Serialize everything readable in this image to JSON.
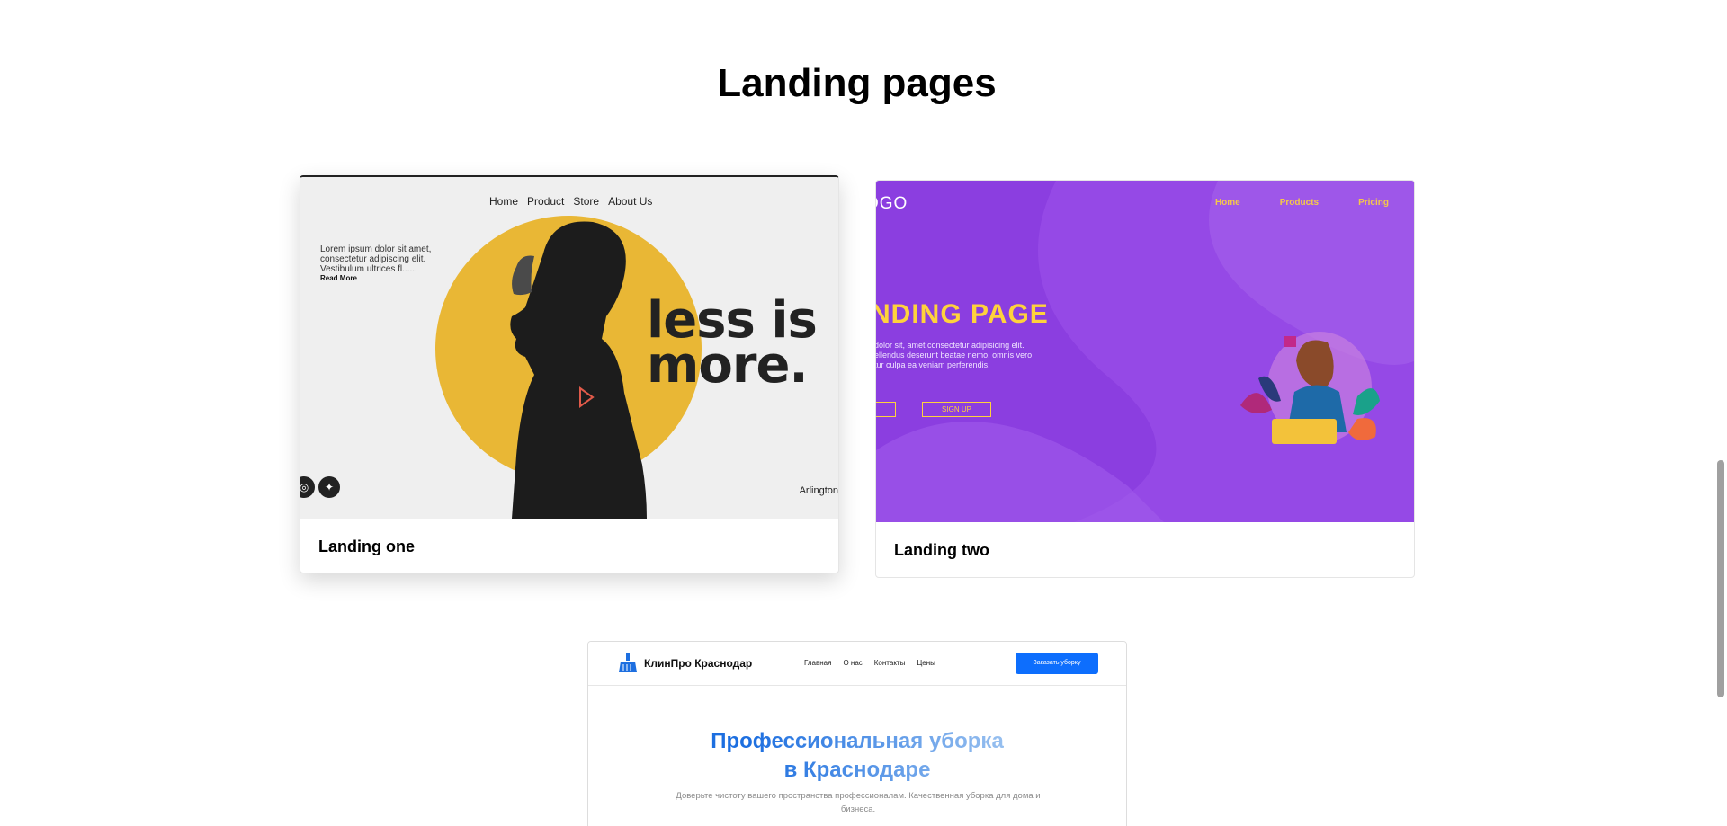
{
  "section": {
    "title": "Landing pages"
  },
  "cards": {
    "one": {
      "label": "Landing one",
      "nav": [
        "Home",
        "Product",
        "Store",
        "About Us"
      ],
      "intro": "Lorem ipsum dolor sit amet, consectetur adipiscing elit. Vestibulum ultrices fl......",
      "read_more": "Read More",
      "headline_line1": "less is",
      "headline_line2": "more.",
      "city": "Arlington",
      "accent": "#e9b735"
    },
    "two": {
      "label": "Landing two",
      "logo": "OGO",
      "nav": [
        "Home",
        "Products",
        "Pricing"
      ],
      "headline": "NDING PAGE",
      "text": " dolor sit, amet consectetur adipisicing elit. ellendus deserunt beatae nemo, omnis vero tur culpa ea veniam perferendis.",
      "signup": "SIGN UP",
      "accent": "#8b3ee0"
    },
    "three": {
      "brand": "КлинПро Краснодар",
      "nav": [
        "Главная",
        "О нас",
        "Контакты",
        "Цены"
      ],
      "cta": "Заказать уборку",
      "title_line1": "Профессиональная уборка",
      "title_line2": "в Краснодаре",
      "subtitle": "Доверьте чистоту вашего пространства профессионалам. Качественная уборка для дома и бизнеса.",
      "accent": "#0d6efd"
    }
  }
}
